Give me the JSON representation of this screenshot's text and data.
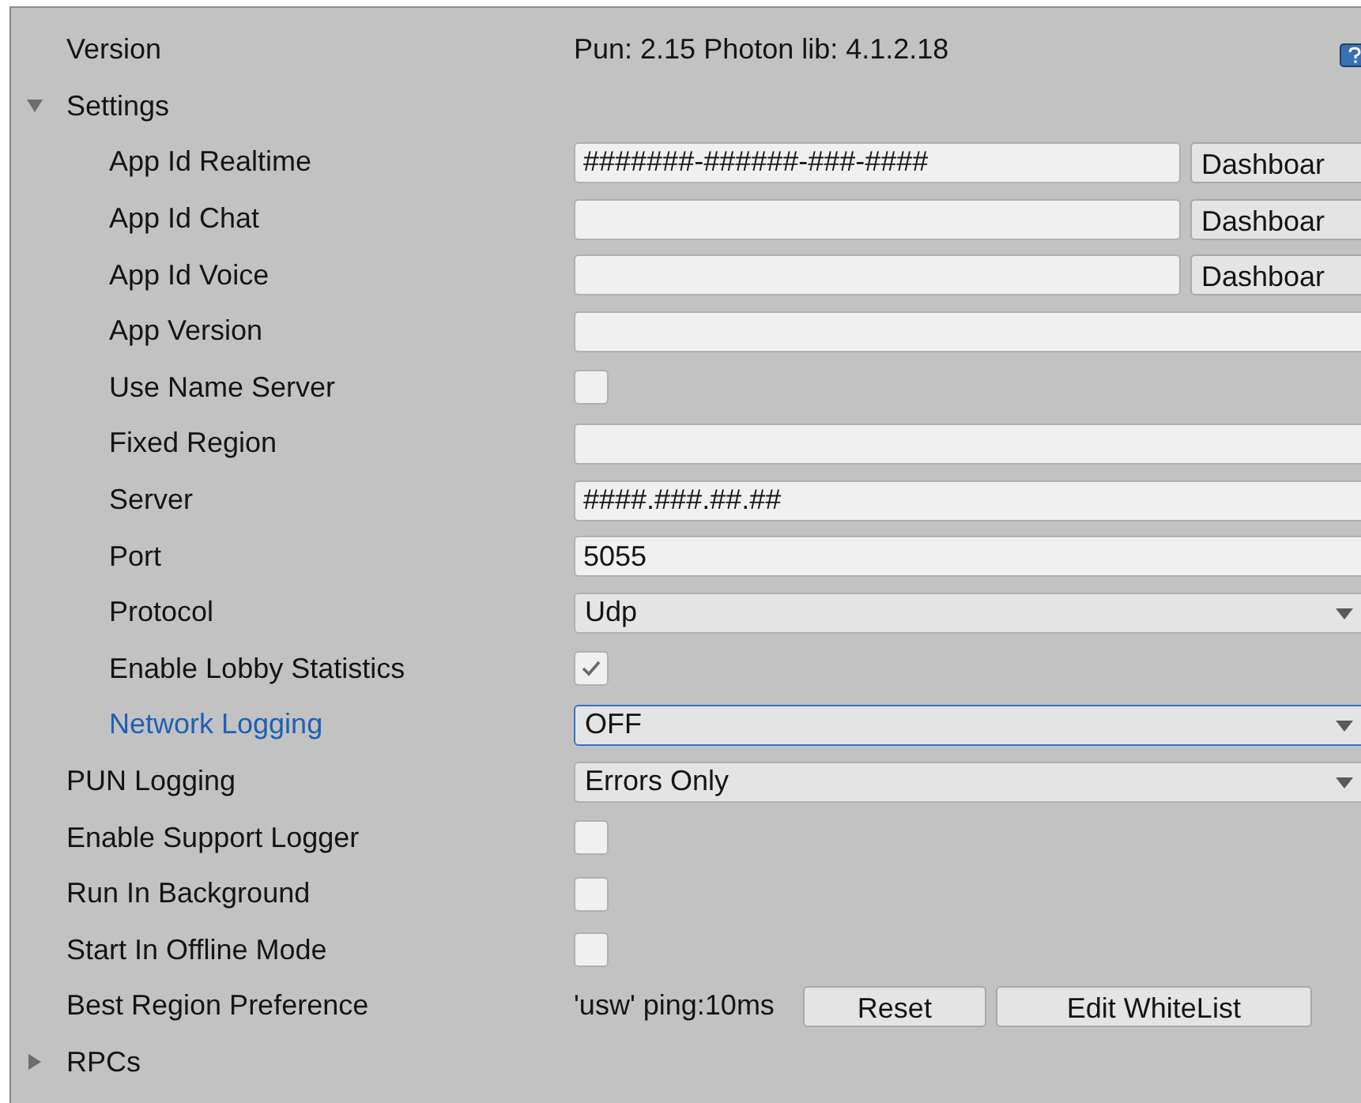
{
  "rows": [
    {
      "kind": "text",
      "label": "Version",
      "value": "Pun: 2.15 Photon lib: 4.1.2.18"
    },
    {
      "kind": "foldout",
      "label": "Settings",
      "expanded": true,
      "children": [
        {
          "kind": "field_button",
          "label": "App Id Realtime",
          "value": "#######-######-###-####",
          "button": "Dashboar"
        },
        {
          "kind": "field_button",
          "label": "App Id Chat",
          "button": "Dashboar"
        },
        {
          "kind": "field_button",
          "label": "App Id Voice",
          "button": "Dashboar"
        },
        {
          "kind": "field",
          "label": "App Version"
        },
        {
          "kind": "checkbox",
          "label": "Use Name Server",
          "checked": false
        },
        {
          "kind": "field",
          "label": "Fixed Region"
        },
        {
          "kind": "field",
          "label": "Server",
          "value": "####.###.##.##"
        },
        {
          "kind": "field",
          "label": "Port",
          "value": "5055"
        },
        {
          "kind": "dropdown",
          "label": "Protocol",
          "value": "Udp",
          "focused": false
        },
        {
          "kind": "checkbox",
          "label": "Enable Lobby Statistics",
          "checked": true
        },
        {
          "kind": "dropdown",
          "label": "Network Logging",
          "value": "OFF",
          "focused": true
        }
      ]
    },
    {
      "kind": "dropdown",
      "label": "PUN Logging",
      "value": "Errors Only",
      "focused": false
    },
    {
      "kind": "checkbox",
      "label": "Enable Support Logger",
      "checked": false
    },
    {
      "kind": "checkbox",
      "label": "Run In Background",
      "checked": false
    },
    {
      "kind": "checkbox",
      "label": "Start In Offline Mode",
      "checked": false
    },
    {
      "kind": "region",
      "label": "Best Region Preference",
      "value": "'usw' ping:10ms",
      "buttons": [
        "Reset",
        "Edit WhiteList"
      ]
    },
    {
      "kind": "foldout",
      "label": "RPCs",
      "expanded": false
    }
  ]
}
